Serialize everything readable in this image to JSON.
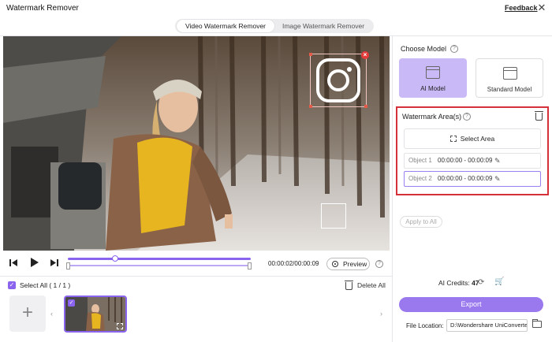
{
  "app": {
    "title": "Watermark Remover",
    "feedback": "Feedback",
    "close_symbol": "✕"
  },
  "mode_tabs": [
    {
      "label": "Video Watermark Remover",
      "active": true
    },
    {
      "label": "Image Watermark Remover",
      "active": false
    }
  ],
  "player": {
    "time_current": "00:00:02",
    "time_total": "00:00:09",
    "time_display": "00:00:02/00:00:09",
    "preview_label": "Preview",
    "progress_fraction": 0.26,
    "icons": {
      "prev": "skip-back-icon",
      "play": "play-icon",
      "next": "skip-forward-icon"
    }
  },
  "clips": {
    "select_all_label": "Select All ( 1 / 1 )",
    "delete_all_label": "Delete All",
    "add_symbol": "+",
    "prev_symbol": "‹",
    "next_symbol": "›"
  },
  "model": {
    "title": "Choose Model",
    "options": [
      {
        "label": "AI Model",
        "selected": true
      },
      {
        "label": "Standard Model",
        "selected": false
      }
    ]
  },
  "watermark_area": {
    "title": "Watermark Area(s)",
    "select_area_label": "Select Area",
    "objects": [
      {
        "name": "Object 1",
        "range": "00:00:00 - 00:00:09"
      },
      {
        "name": "Object 2",
        "range": "00:00:00 - 00:00:09"
      }
    ]
  },
  "apply_to_all": "Apply to All",
  "credits": {
    "label": "AI Credits:",
    "value": "47"
  },
  "export_label": "Export",
  "file_location": {
    "label": "File Location:",
    "value": "D:\\Wondershare UniConverter"
  },
  "colors": {
    "accent": "#8a63ee",
    "highlight_border": "#d6303a",
    "export": "#9a78ee"
  }
}
